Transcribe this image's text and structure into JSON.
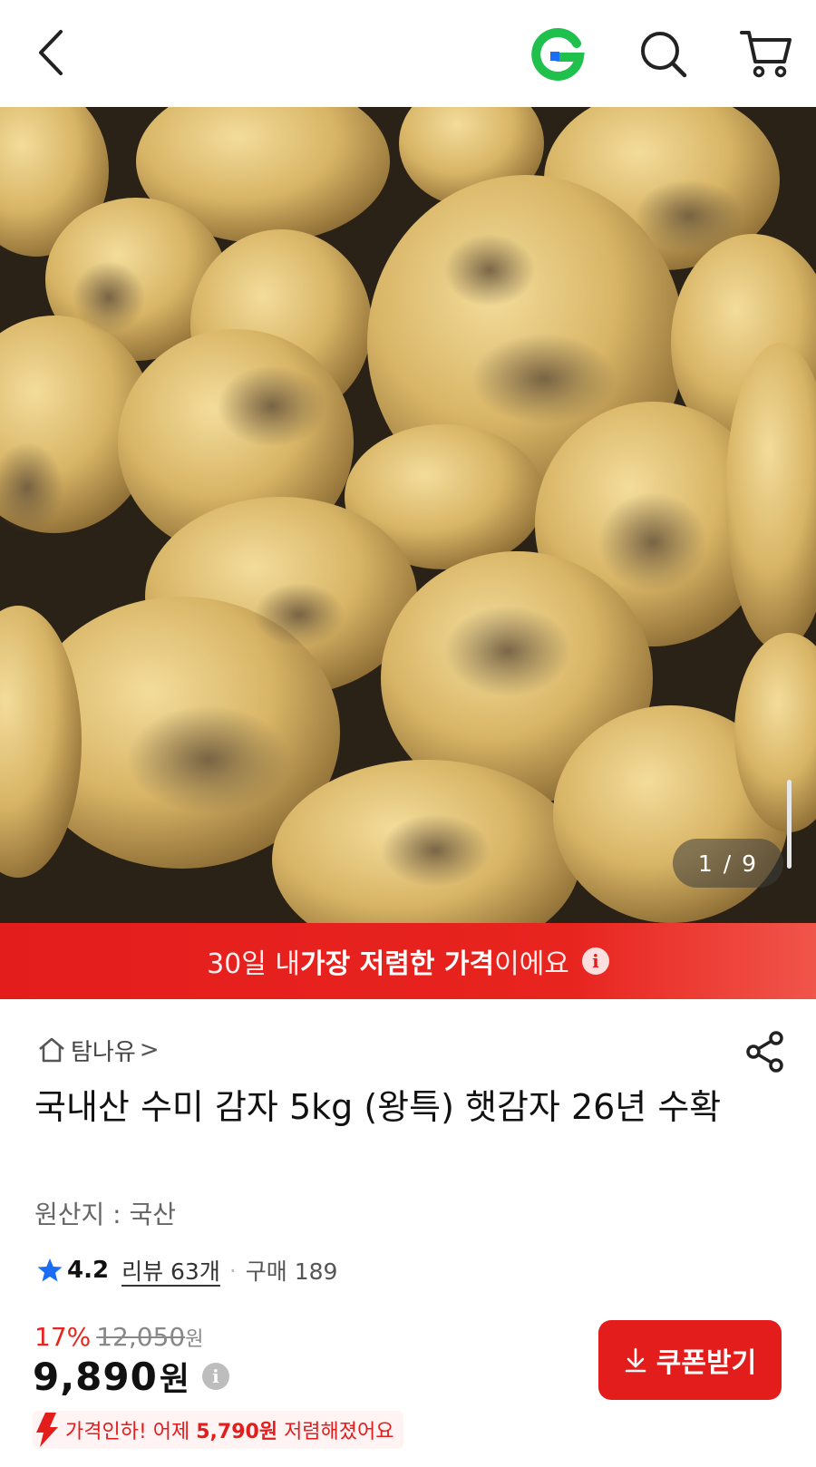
{
  "header": {
    "back_icon": "chevron-left-icon",
    "logo_icon": "g-logo-icon",
    "search_icon": "search-icon",
    "cart_icon": "cart-icon",
    "logo_colors": {
      "green": "#1fc04b",
      "blue": "#1a6ef5"
    }
  },
  "gallery": {
    "counter": "1 / 9"
  },
  "promo": {
    "pre": "30일 내 ",
    "bold": "가장 저렴한 가격",
    "post": "이에요",
    "info_icon": "i",
    "color": "#e31d1c"
  },
  "product": {
    "store_name": "탐나유",
    "store_chevron": ">",
    "title": "국내산 수미 감자 5kg (왕특) 햇감자 26년 수확",
    "origin": "원산지 : 국산",
    "rating": "4.2",
    "reviews": "리뷰 63개",
    "separator": "·",
    "purchases": "구매 189"
  },
  "price": {
    "discount": "17%",
    "original": "12,050",
    "original_unit": "원",
    "current": "9,890",
    "current_unit": "원",
    "info_icon": "i",
    "coupon_label": "쿠폰받기",
    "drop_pre": "가격인하! 어제 ",
    "drop_amount": "5,790원",
    "drop_post": " 저렴해졌어요"
  }
}
